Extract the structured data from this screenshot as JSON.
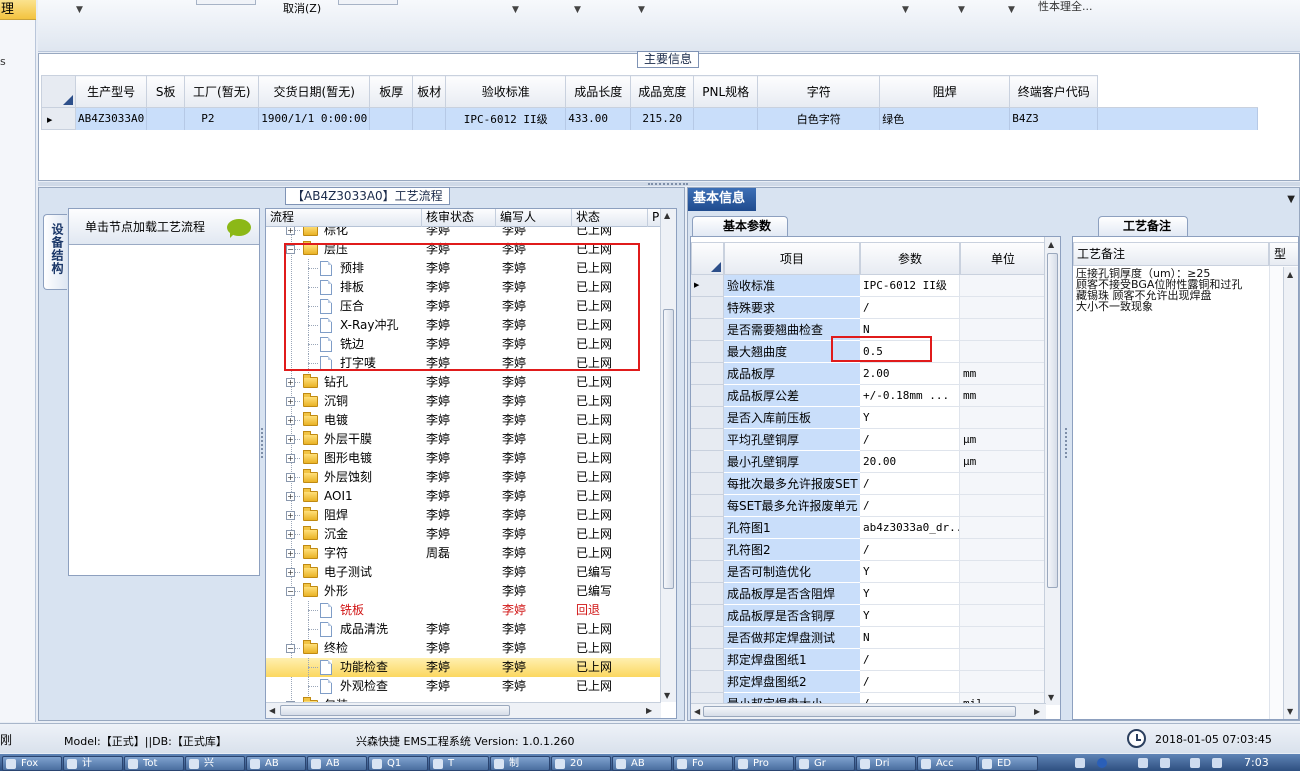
{
  "left_strip": {
    "selected_label": "理",
    "small_label": "s"
  },
  "toolbar": {
    "cancel_label": "取消(Z)",
    "fragment_label": "性本理全..."
  },
  "main_info": {
    "title": "主要信息",
    "columns": [
      "生产型号",
      "S板",
      "工厂(暂无)",
      "交货日期(暂无)",
      "板厚",
      "板材",
      "验收标准",
      "成品长度",
      "成品宽度",
      "PNL规格",
      "字符",
      "阻焊",
      "终端客户代码"
    ],
    "row": [
      "AB4Z3033A0",
      "",
      "P2",
      "1900/1/1 0:00:00",
      "",
      "",
      "IPC-6012 II级",
      "433.00",
      "215.20",
      "",
      "白色字符",
      "绿色",
      "B4Z3"
    ]
  },
  "process": {
    "title": "【AB4Z3033A0】工艺流程",
    "side_tab": "设备结构",
    "node_panel_header": "单击节点加载工艺流程",
    "columns": [
      "流程",
      "核审状态",
      "编写人",
      "状态",
      "P"
    ],
    "rows": [
      {
        "level": 0,
        "kind": "folder",
        "expanded": false,
        "name": "棕化",
        "review": "李婷",
        "writer": "李婷",
        "status": "已上网"
      },
      {
        "level": 0,
        "kind": "folder",
        "expanded": true,
        "name": "层压",
        "review": "李婷",
        "writer": "李婷",
        "status": "已上网"
      },
      {
        "level": 1,
        "kind": "doc",
        "name": "预排",
        "review": "李婷",
        "writer": "李婷",
        "status": "已上网"
      },
      {
        "level": 1,
        "kind": "doc",
        "name": "排板",
        "review": "李婷",
        "writer": "李婷",
        "status": "已上网"
      },
      {
        "level": 1,
        "kind": "doc",
        "name": "压合",
        "review": "李婷",
        "writer": "李婷",
        "status": "已上网"
      },
      {
        "level": 1,
        "kind": "doc",
        "name": "X-Ray冲孔",
        "review": "李婷",
        "writer": "李婷",
        "status": "已上网"
      },
      {
        "level": 1,
        "kind": "doc",
        "name": "铣边",
        "review": "李婷",
        "writer": "李婷",
        "status": "已上网"
      },
      {
        "level": 1,
        "kind": "doc",
        "name": "打字唛",
        "review": "李婷",
        "writer": "李婷",
        "status": "已上网"
      },
      {
        "level": 0,
        "kind": "folder",
        "expanded": false,
        "name": "钻孔",
        "review": "李婷",
        "writer": "李婷",
        "status": "已上网"
      },
      {
        "level": 0,
        "kind": "folder",
        "expanded": false,
        "name": "沉铜",
        "review": "李婷",
        "writer": "李婷",
        "status": "已上网"
      },
      {
        "level": 0,
        "kind": "folder",
        "expanded": false,
        "name": "电镀",
        "review": "李婷",
        "writer": "李婷",
        "status": "已上网"
      },
      {
        "level": 0,
        "kind": "folder",
        "expanded": false,
        "name": "外层干膜",
        "review": "李婷",
        "writer": "李婷",
        "status": "已上网"
      },
      {
        "level": 0,
        "kind": "folder",
        "expanded": false,
        "name": "图形电镀",
        "review": "李婷",
        "writer": "李婷",
        "status": "已上网"
      },
      {
        "level": 0,
        "kind": "folder",
        "expanded": false,
        "name": "外层蚀刻",
        "review": "李婷",
        "writer": "李婷",
        "status": "已上网"
      },
      {
        "level": 0,
        "kind": "folder",
        "expanded": false,
        "name": "AOI1",
        "review": "李婷",
        "writer": "李婷",
        "status": "已上网"
      },
      {
        "level": 0,
        "kind": "folder",
        "expanded": false,
        "name": "阻焊",
        "review": "李婷",
        "writer": "李婷",
        "status": "已上网"
      },
      {
        "level": 0,
        "kind": "folder",
        "expanded": false,
        "name": "沉金",
        "review": "李婷",
        "writer": "李婷",
        "status": "已上网"
      },
      {
        "level": 0,
        "kind": "folder",
        "expanded": false,
        "name": "字符",
        "review": "周磊",
        "writer": "李婷",
        "status": "已上网"
      },
      {
        "level": 0,
        "kind": "folder",
        "expanded": false,
        "name": "电子测试",
        "review": "",
        "writer": "李婷",
        "status": "已编写"
      },
      {
        "level": 0,
        "kind": "folder",
        "expanded": true,
        "name": "外形",
        "review": "",
        "writer": "李婷",
        "status": "已编写"
      },
      {
        "level": 1,
        "kind": "doc",
        "name": "铣板",
        "review": "",
        "writer": "李婷",
        "status": "回退",
        "red": true
      },
      {
        "level": 1,
        "kind": "doc",
        "name": "成品清洗",
        "review": "李婷",
        "writer": "李婷",
        "status": "已上网"
      },
      {
        "level": 0,
        "kind": "folder",
        "expanded": true,
        "name": "终检",
        "review": "李婷",
        "writer": "李婷",
        "status": "已上网"
      },
      {
        "level": 1,
        "kind": "doc",
        "name": "功能检查",
        "review": "李婷",
        "writer": "李婷",
        "status": "已上网",
        "selected": true
      },
      {
        "level": 1,
        "kind": "doc",
        "name": "外观检查",
        "review": "李婷",
        "writer": "李婷",
        "status": "已上网"
      },
      {
        "level": 0,
        "kind": "folder",
        "expanded": false,
        "name": "包装",
        "review": "",
        "writer": "",
        "status": ""
      }
    ]
  },
  "basic_info": {
    "title": "基本信息",
    "param_tab": "基本参数",
    "columns": [
      "项目",
      "参数",
      "单位"
    ],
    "rows": [
      {
        "item": "验收标准",
        "value": "IPC-6012 II级",
        "unit": ""
      },
      {
        "item": "特殊要求",
        "value": "/",
        "unit": ""
      },
      {
        "item": "是否需要翘曲检查",
        "value": "N",
        "unit": ""
      },
      {
        "item": "最大翘曲度",
        "value": "0.5",
        "unit": ""
      },
      {
        "item": "成品板厚",
        "value": "2.00",
        "unit": "mm"
      },
      {
        "item": "成品板厚公差",
        "value": "+/-0.18mm   ...",
        "unit": "mm"
      },
      {
        "item": "是否入库前压板",
        "value": "Y",
        "unit": ""
      },
      {
        "item": "平均孔壁铜厚",
        "value": "/",
        "unit": "μm"
      },
      {
        "item": "最小孔壁铜厚",
        "value": "20.00",
        "unit": "μm"
      },
      {
        "item": "每批次最多允许报废SET",
        "value": "/",
        "unit": ""
      },
      {
        "item": "每SET最多允许报废单元",
        "value": "/",
        "unit": ""
      },
      {
        "item": "孔符图1",
        "value": "ab4z3033a0_dr...",
        "unit": ""
      },
      {
        "item": "孔符图2",
        "value": "/",
        "unit": ""
      },
      {
        "item": "是否可制造优化",
        "value": "Y",
        "unit": ""
      },
      {
        "item": "成品板厚是否含阻焊",
        "value": "Y",
        "unit": ""
      },
      {
        "item": "成品板厚是否含铜厚",
        "value": "Y",
        "unit": ""
      },
      {
        "item": "是否做邦定焊盘测试",
        "value": "N",
        "unit": ""
      },
      {
        "item": "邦定焊盘图纸1",
        "value": "/",
        "unit": ""
      },
      {
        "item": "邦定焊盘图纸2",
        "value": "/",
        "unit": ""
      },
      {
        "item": "最小邦定焊盘大小",
        "value": "/",
        "unit": "mil"
      }
    ],
    "note_tab": "工艺备注",
    "note_columns": [
      "工艺备注",
      "型"
    ],
    "note_lines": [
      "压接孔铜厚度（um）：≥25",
      "顾客不接受BGA位附性露铜和过孔",
      "藏锡珠    顾客不允许出现焊盘",
      "大小不一致现象"
    ]
  },
  "status_bar": {
    "left_fragment": "刚",
    "model_db": "Model:【正式】||DB:【正式库】",
    "app_version": "兴森快捷 EMS工程系统 Version: 1.0.1.260",
    "datetime": "2018-01-05 07:03:45"
  },
  "taskbar": {
    "buttons": [
      "Fox",
      "计",
      "Tot",
      "兴",
      "AB",
      "AB",
      "Q1",
      "T",
      "制",
      "20",
      "AB",
      "Fo",
      "Pro",
      "Gr",
      "Dri",
      "Acc",
      "ED"
    ],
    "time": "7:03"
  }
}
